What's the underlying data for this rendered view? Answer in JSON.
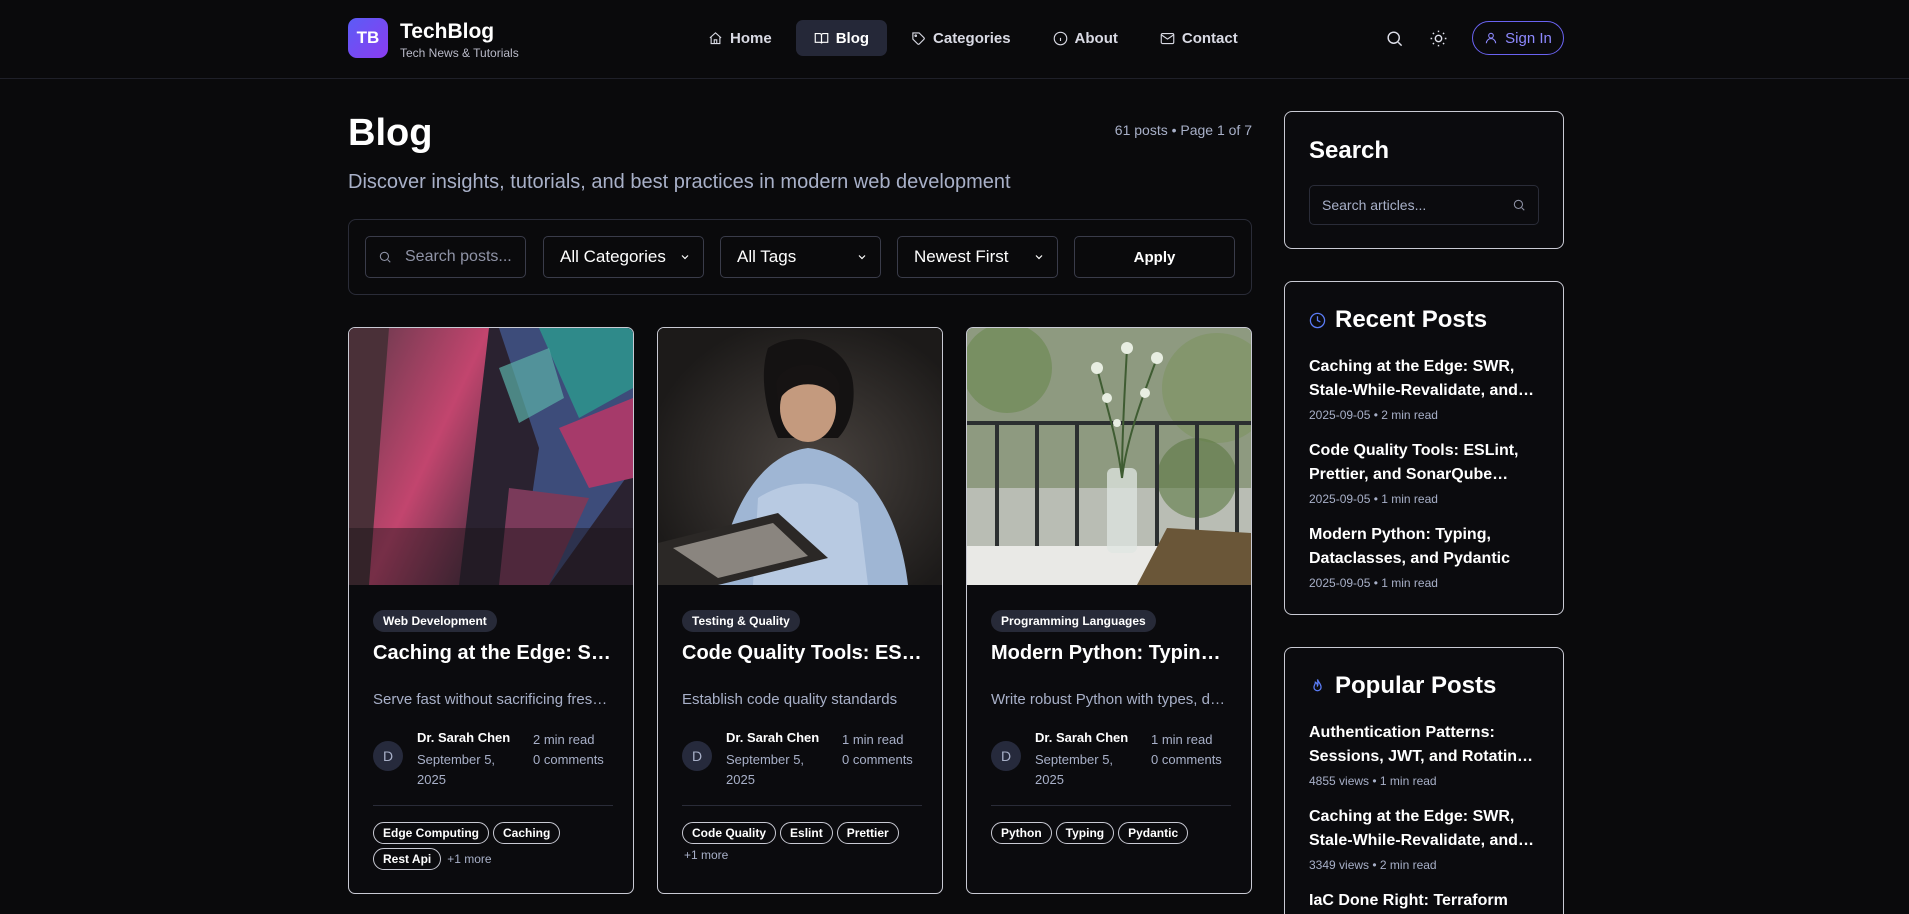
{
  "brand": {
    "logo_text": "TB",
    "title": "TechBlog",
    "subtitle": "Tech News & Tutorials"
  },
  "nav": {
    "items": [
      {
        "label": "Home",
        "icon": "home-icon"
      },
      {
        "label": "Blog",
        "icon": "book-icon",
        "active": true
      },
      {
        "label": "Categories",
        "icon": "tag-icon"
      },
      {
        "label": "About",
        "icon": "info-icon"
      },
      {
        "label": "Contact",
        "icon": "mail-icon"
      }
    ]
  },
  "header_actions": {
    "search_icon": "search-icon",
    "theme_icon": "sun-icon",
    "signin_label": "Sign In"
  },
  "page": {
    "title": "Blog",
    "subtitle": "Discover insights, tutorials, and best practices in modern web development",
    "meta": "61 posts • Page 1 of 7"
  },
  "filters": {
    "search_placeholder": "Search posts...",
    "category_selected": "All Categories",
    "tag_selected": "All Tags",
    "sort_selected": "Newest First",
    "apply_label": "Apply"
  },
  "posts": [
    {
      "category": "Web Development",
      "title": "Caching at the Edge: SWR, Stale-While-Revalidate, and CDN Strategies",
      "excerpt": "Serve fast without sacrificing freshness",
      "avatar": "D",
      "author": "Dr. Sarah Chen",
      "date": "September 5, 2025",
      "read_time": "2 min read",
      "comments": "0 comments",
      "tags": [
        "Edge Computing",
        "Caching",
        "Rest Api"
      ],
      "more": "+1 more"
    },
    {
      "category": "Testing & Quality",
      "title": "Code Quality Tools: ESLint, Prettier, and SonarQube Setup",
      "excerpt": "Establish code quality standards",
      "avatar": "D",
      "author": "Dr. Sarah Chen",
      "date": "September 5, 2025",
      "read_time": "1 min read",
      "comments": "0 comments",
      "tags": [
        "Code Quality",
        "Eslint",
        "Prettier"
      ],
      "more": "+1 more"
    },
    {
      "category": "Programming Languages",
      "title": "Modern Python: Typing, Dataclasses, and Pydantic",
      "excerpt": "Write robust Python with types, dataclasses",
      "avatar": "D",
      "author": "Dr. Sarah Chen",
      "date": "September 5, 2025",
      "read_time": "1 min read",
      "comments": "0 comments",
      "tags": [
        "Python",
        "Typing",
        "Pydantic"
      ],
      "more": ""
    }
  ],
  "sidebar": {
    "search": {
      "title": "Search",
      "placeholder": "Search articles..."
    },
    "recent": {
      "title": "Recent Posts",
      "icon": "clock-icon",
      "items": [
        {
          "title": "Caching at the Edge: SWR, Stale-While-Revalidate, and CDN Strategies",
          "meta": "2025-09-05 • 2 min read"
        },
        {
          "title": "Code Quality Tools: ESLint, Prettier, and SonarQube Setup",
          "meta": "2025-09-05 • 1 min read"
        },
        {
          "title": "Modern Python: Typing, Dataclasses, and Pydantic",
          "meta": "2025-09-05 • 1 min read"
        }
      ]
    },
    "popular": {
      "title": "Popular Posts",
      "icon": "flame-icon",
      "items": [
        {
          "title": "Authentication Patterns: Sessions, JWT, and Rotating Tokens",
          "meta": "4855 views • 1 min read"
        },
        {
          "title": "Caching at the Edge: SWR, Stale-While-Revalidate, and CDN Strategies",
          "meta": "3349 views • 2 min read"
        },
        {
          "title": "IaC Done Right: Terraform",
          "meta": ""
        }
      ]
    }
  },
  "colors": {
    "accent": "#6a63f2",
    "background": "#0a0a0c",
    "muted_text": "#a8b0c8",
    "badge_bg": "#272a38"
  }
}
